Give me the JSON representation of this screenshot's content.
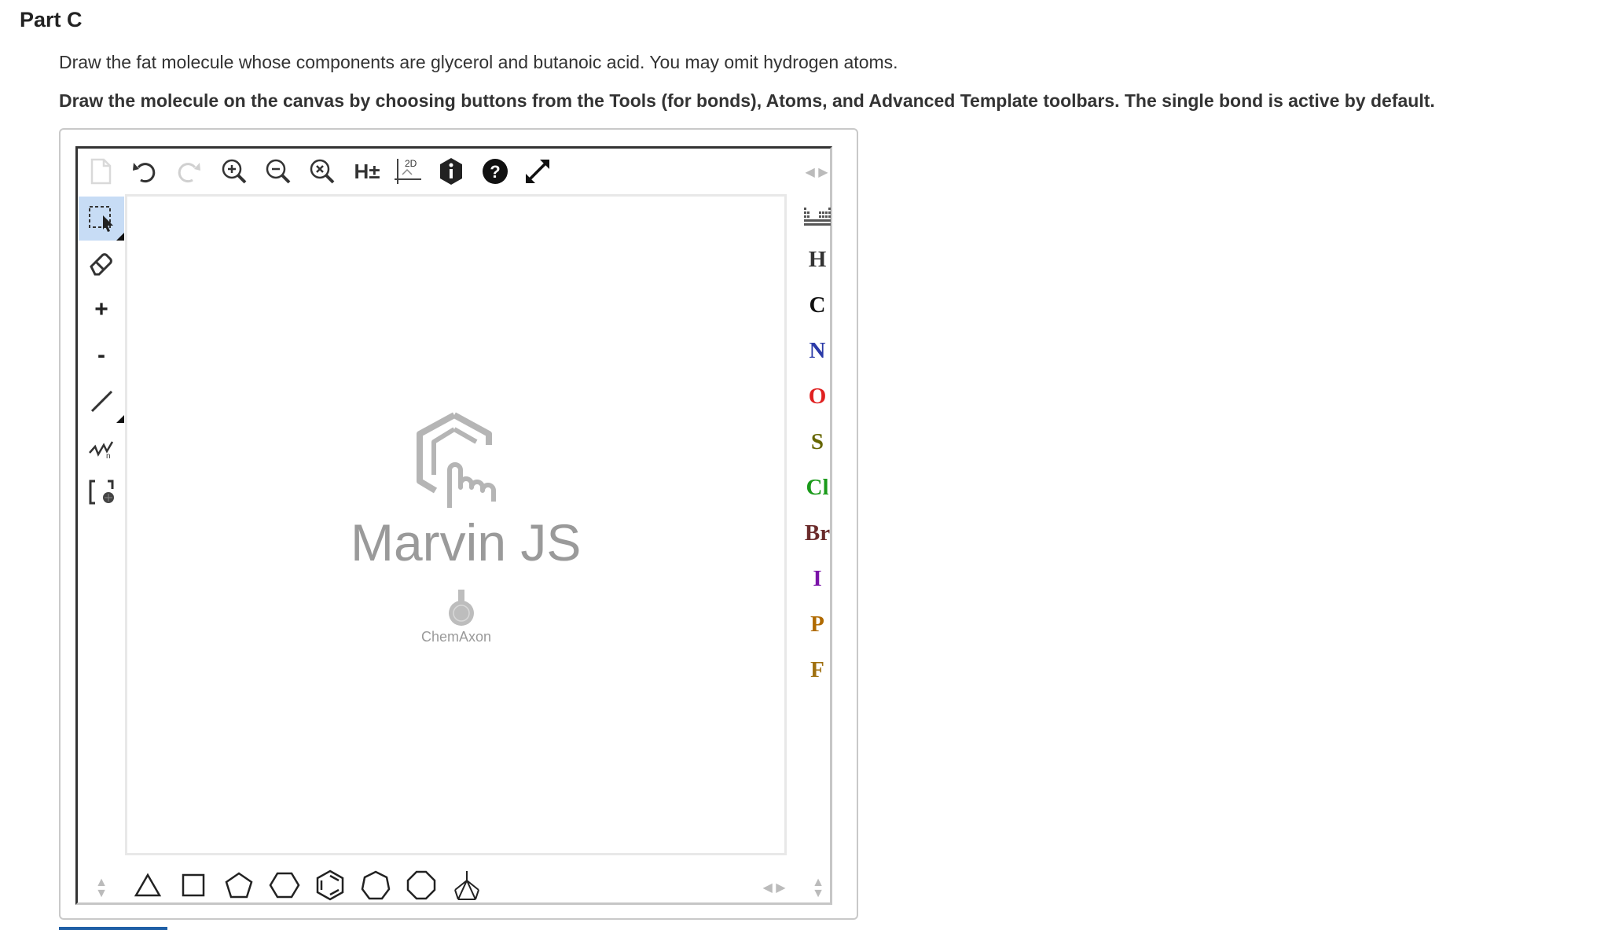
{
  "part": {
    "title": "Part C"
  },
  "question": {
    "instruction": "Draw the fat molecule whose components are glycerol and butanoic acid. You may omit hydrogen atoms.",
    "tool_instruction": "Draw the molecule on the canvas by choosing buttons from the Tools (for bonds), Atoms, and Advanced Template toolbars. The single bond is active by default."
  },
  "editor": {
    "name": "Marvin JS",
    "vendor": "ChemAxon",
    "top_toolbar": {
      "icons": [
        "new-document-icon",
        "undo-icon",
        "redo-icon",
        "zoom-in-icon",
        "zoom-out-icon",
        "zoom-reset-icon",
        "hydrogens-icon",
        "clean-2d-icon",
        "info-icon",
        "help-icon",
        "fullscreen-icon"
      ],
      "hydrogens_label": "H±",
      "clean_label": "2D"
    },
    "left_toolbar": {
      "plus_label": "+",
      "minus_label": "-"
    },
    "right_toolbar": {
      "atoms": [
        {
          "symbol": "H",
          "color": "#333333"
        },
        {
          "symbol": "C",
          "color": "#111111"
        },
        {
          "symbol": "N",
          "color": "#2b3aa8"
        },
        {
          "symbol": "O",
          "color": "#e02020"
        },
        {
          "symbol": "S",
          "color": "#666600"
        },
        {
          "symbol": "Cl",
          "color": "#1a9a1a"
        },
        {
          "symbol": "Br",
          "color": "#6b2b2b"
        },
        {
          "symbol": "I",
          "color": "#7a12a8"
        },
        {
          "symbol": "P",
          "color": "#b06a00"
        },
        {
          "symbol": "F",
          "color": "#a07010"
        }
      ]
    },
    "bottom_toolbar": {
      "templates": [
        "cyclopropane-template",
        "cyclobutane-template",
        "cyclopentane-template",
        "cyclohexane-template",
        "benzene-template",
        "cycloheptane-template",
        "cyclooctane-template",
        "more-templates"
      ]
    }
  },
  "colors": {
    "active_tool_bg": "#c7dcf5",
    "accent_blue": "#1f5fa6",
    "logo_gray": "#9a9a9a"
  }
}
